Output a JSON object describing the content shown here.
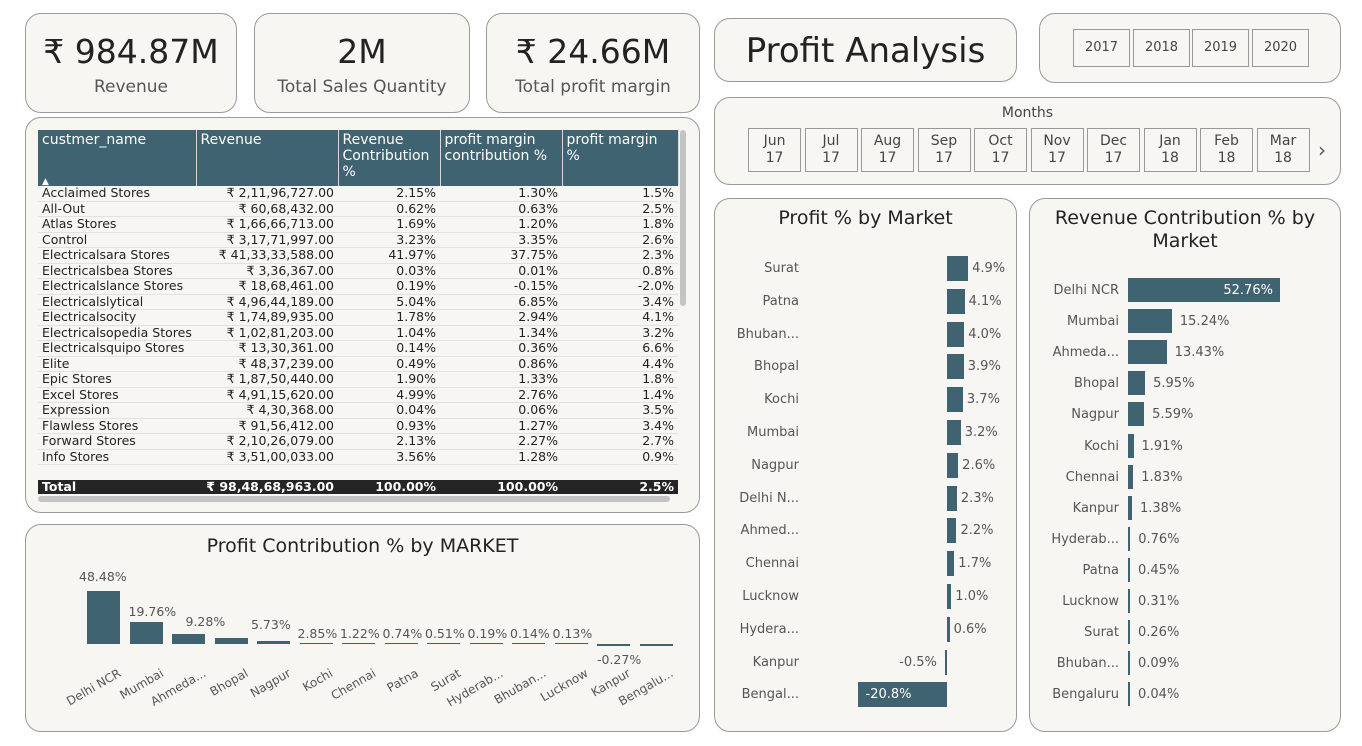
{
  "kpis": [
    {
      "value": "₹ 984.87M",
      "label": "Revenue"
    },
    {
      "value": "2M",
      "label": "Total Sales Quantity"
    },
    {
      "value": "₹ 24.66M",
      "label": "Total profit margin"
    }
  ],
  "page_title": "Profit Analysis",
  "years": [
    "2017",
    "2018",
    "2019",
    "2020"
  ],
  "months": {
    "label": "Months",
    "items": [
      {
        "m": "Jun",
        "y": "17"
      },
      {
        "m": "Jul",
        "y": "17"
      },
      {
        "m": "Aug",
        "y": "17"
      },
      {
        "m": "Sep",
        "y": "17"
      },
      {
        "m": "Oct",
        "y": "17"
      },
      {
        "m": "Nov",
        "y": "17"
      },
      {
        "m": "Dec",
        "y": "17"
      },
      {
        "m": "Jan",
        "y": "18"
      },
      {
        "m": "Feb",
        "y": "18"
      },
      {
        "m": "Mar",
        "y": "18"
      }
    ],
    "next_icon": "chevron-right-icon"
  },
  "table": {
    "headers": [
      "custmer_name",
      "Revenue",
      "Revenue Contribution %",
      "profit margin contribution %",
      "profit margin %"
    ],
    "sort_icon": "sort-up-icon",
    "rows": [
      [
        "Acclaimed Stores",
        "₹ 2,11,96,727.00",
        "2.15%",
        "1.30%",
        "1.5%"
      ],
      [
        "All-Out",
        "₹ 60,68,432.00",
        "0.62%",
        "0.63%",
        "2.5%"
      ],
      [
        "Atlas Stores",
        "₹ 1,66,66,713.00",
        "1.69%",
        "1.20%",
        "1.8%"
      ],
      [
        "Control",
        "₹ 3,17,71,997.00",
        "3.23%",
        "3.35%",
        "2.6%"
      ],
      [
        "Electricalsara Stores",
        "₹ 41,33,33,588.00",
        "41.97%",
        "37.75%",
        "2.3%"
      ],
      [
        "Electricalsbea Stores",
        "₹ 3,36,367.00",
        "0.03%",
        "0.01%",
        "0.8%"
      ],
      [
        "Electricalslance Stores",
        "₹ 18,68,461.00",
        "0.19%",
        "-0.15%",
        "-2.0%"
      ],
      [
        "Electricalslytical",
        "₹ 4,96,44,189.00",
        "5.04%",
        "6.85%",
        "3.4%"
      ],
      [
        "Electricalsocity",
        "₹ 1,74,89,935.00",
        "1.78%",
        "2.94%",
        "4.1%"
      ],
      [
        "Electricalsopedia Stores",
        "₹ 1,02,81,203.00",
        "1.04%",
        "1.34%",
        "3.2%"
      ],
      [
        "Electricalsquipo Stores",
        "₹ 13,30,361.00",
        "0.14%",
        "0.36%",
        "6.6%"
      ],
      [
        "Elite",
        "₹ 48,37,239.00",
        "0.49%",
        "0.86%",
        "4.4%"
      ],
      [
        "Epic Stores",
        "₹ 1,87,50,440.00",
        "1.90%",
        "1.33%",
        "1.8%"
      ],
      [
        "Excel Stores",
        "₹ 4,91,15,620.00",
        "4.99%",
        "2.76%",
        "1.4%"
      ],
      [
        "Expression",
        "₹ 4,30,368.00",
        "0.04%",
        "0.06%",
        "3.5%"
      ],
      [
        "Flawless Stores",
        "₹ 91,56,412.00",
        "0.93%",
        "1.27%",
        "3.4%"
      ],
      [
        "Forward Stores",
        "₹ 2,10,26,079.00",
        "2.13%",
        "2.27%",
        "2.7%"
      ],
      [
        "Info Stores",
        "₹ 3,51,00,033.00",
        "3.56%",
        "1.28%",
        "0.9%"
      ]
    ],
    "total": [
      "Total",
      "₹ 98,48,68,963.00",
      "100.00%",
      "100.00%",
      "2.5%"
    ]
  },
  "chart_data": [
    {
      "type": "bar",
      "title": "Profit Contribution % by MARKET",
      "categories": [
        "Delhi NCR",
        "Mumbai",
        "Ahmeda...",
        "Bhopal",
        "Nagpur",
        "Kochi",
        "Chennai",
        "Patna",
        "Surat",
        "Hyderab...",
        "Bhuban...",
        "Lucknow",
        "Kanpur",
        "Bengalu..."
      ],
      "values": [
        48.48,
        19.76,
        9.28,
        5.73,
        2.85,
        1.22,
        0.74,
        0.51,
        0.19,
        0.14,
        0.13,
        0.03,
        -0.27,
        -0.6
      ],
      "value_labels": [
        "48.48%",
        "19.76%",
        "",
        "9.28%",
        "5.73%",
        "2.85%",
        "1.22%",
        "0.74%",
        "0.51%",
        "0.19%",
        "0.14%",
        "0.13%",
        "-0.27%",
        ""
      ]
    },
    {
      "type": "bar",
      "orientation": "horizontal",
      "title": "Profit % by Market",
      "categories": [
        "Surat",
        "Patna",
        "Bhuban...",
        "Bhopal",
        "Kochi",
        "Mumbai",
        "Nagpur",
        "Delhi N...",
        "Ahmed...",
        "Chennai",
        "Lucknow",
        "Hydera...",
        "Kanpur",
        "Bengal..."
      ],
      "values": [
        4.9,
        4.1,
        4.0,
        3.9,
        3.7,
        3.2,
        2.6,
        2.3,
        2.2,
        1.7,
        1.0,
        0.6,
        -0.5,
        -20.8
      ],
      "value_labels": [
        "4.9%",
        "4.1%",
        "4.0%",
        "3.9%",
        "3.7%",
        "3.2%",
        "2.6%",
        "2.3%",
        "2.2%",
        "1.7%",
        "1.0%",
        "0.6%",
        "-0.5%",
        "-20.8%"
      ]
    },
    {
      "type": "bar",
      "orientation": "horizontal",
      "title": "Revenue Contribution % by Market",
      "categories": [
        "Delhi NCR",
        "Mumbai",
        "Ahmeda...",
        "Bhopal",
        "Nagpur",
        "Kochi",
        "Chennai",
        "Kanpur",
        "Hyderab...",
        "Patna",
        "Lucknow",
        "Surat",
        "Bhuban...",
        "Bengaluru"
      ],
      "values": [
        52.76,
        15.24,
        13.43,
        5.95,
        5.59,
        1.91,
        1.83,
        1.38,
        0.76,
        0.45,
        0.31,
        0.26,
        0.09,
        0.04
      ],
      "value_labels": [
        "52.76%",
        "15.24%",
        "13.43%",
        "5.95%",
        "5.59%",
        "1.91%",
        "1.83%",
        "1.38%",
        "0.76%",
        "0.45%",
        "0.31%",
        "0.26%",
        "0.09%",
        "0.04%"
      ]
    }
  ],
  "colors": {
    "bar": "#3f6370",
    "panel": "#f7f6f2",
    "header": "#3f6370",
    "total_row": "#252525"
  }
}
